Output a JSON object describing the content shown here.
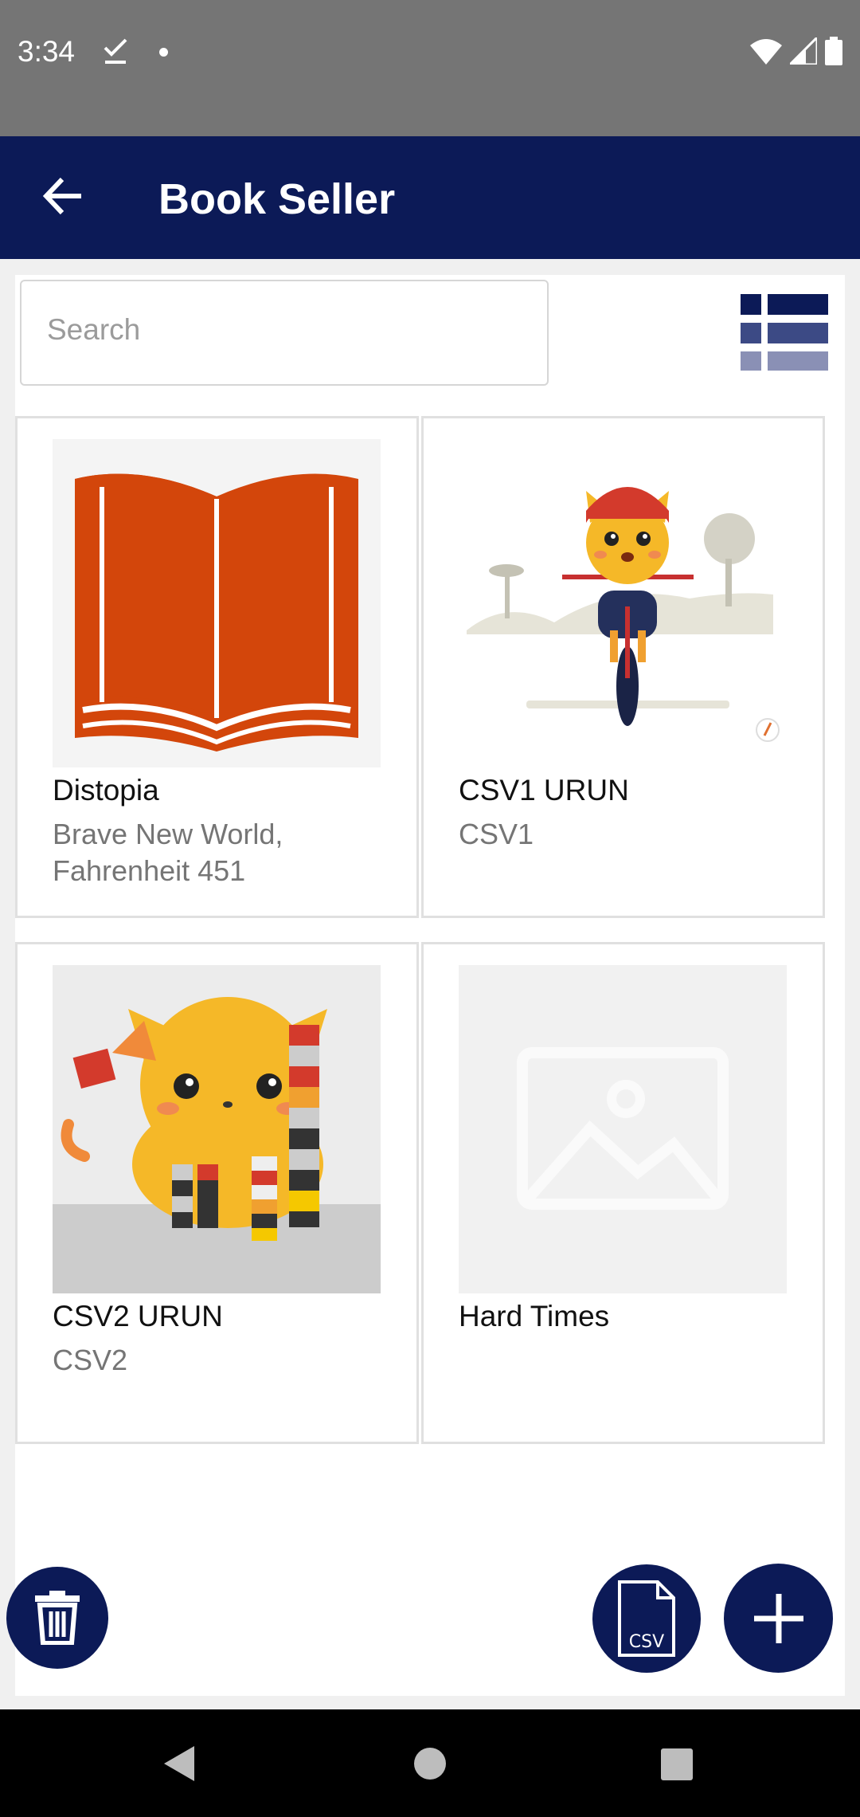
{
  "status_bar": {
    "time": "3:34",
    "icons": [
      "check-notification-icon",
      "dot-notification-icon",
      "wifi-icon",
      "signal-icon",
      "battery-icon"
    ]
  },
  "app_bar": {
    "title": "Book Seller",
    "back_icon": "arrow-left-icon"
  },
  "search": {
    "placeholder": "Search"
  },
  "view_toggle_icon": "list-view-icon",
  "products": [
    {
      "name": "Distopia",
      "description": "Brave New World, Fahrenheit 451",
      "image": "open-book-image"
    },
    {
      "name": "CSV1 URUN",
      "description": "CSV1",
      "image": "cat-on-bicycle-image"
    },
    {
      "name": "CSV2 URUN",
      "description": "CSV2",
      "image": "cat-with-blocks-image"
    },
    {
      "name": "Hard Times",
      "description": "",
      "image": "image-placeholder"
    }
  ],
  "fabs": {
    "delete_icon": "trash-icon",
    "csv_icon": "csv-file-icon",
    "csv_label": "CSV",
    "add_icon": "plus-icon"
  },
  "nav_bar": {
    "icons": [
      "back-triangle-icon",
      "home-circle-icon",
      "recents-square-icon"
    ]
  },
  "colors": {
    "primary": "#0c1a57",
    "status_bar": "#757575",
    "book_orange": "#d3460b"
  }
}
